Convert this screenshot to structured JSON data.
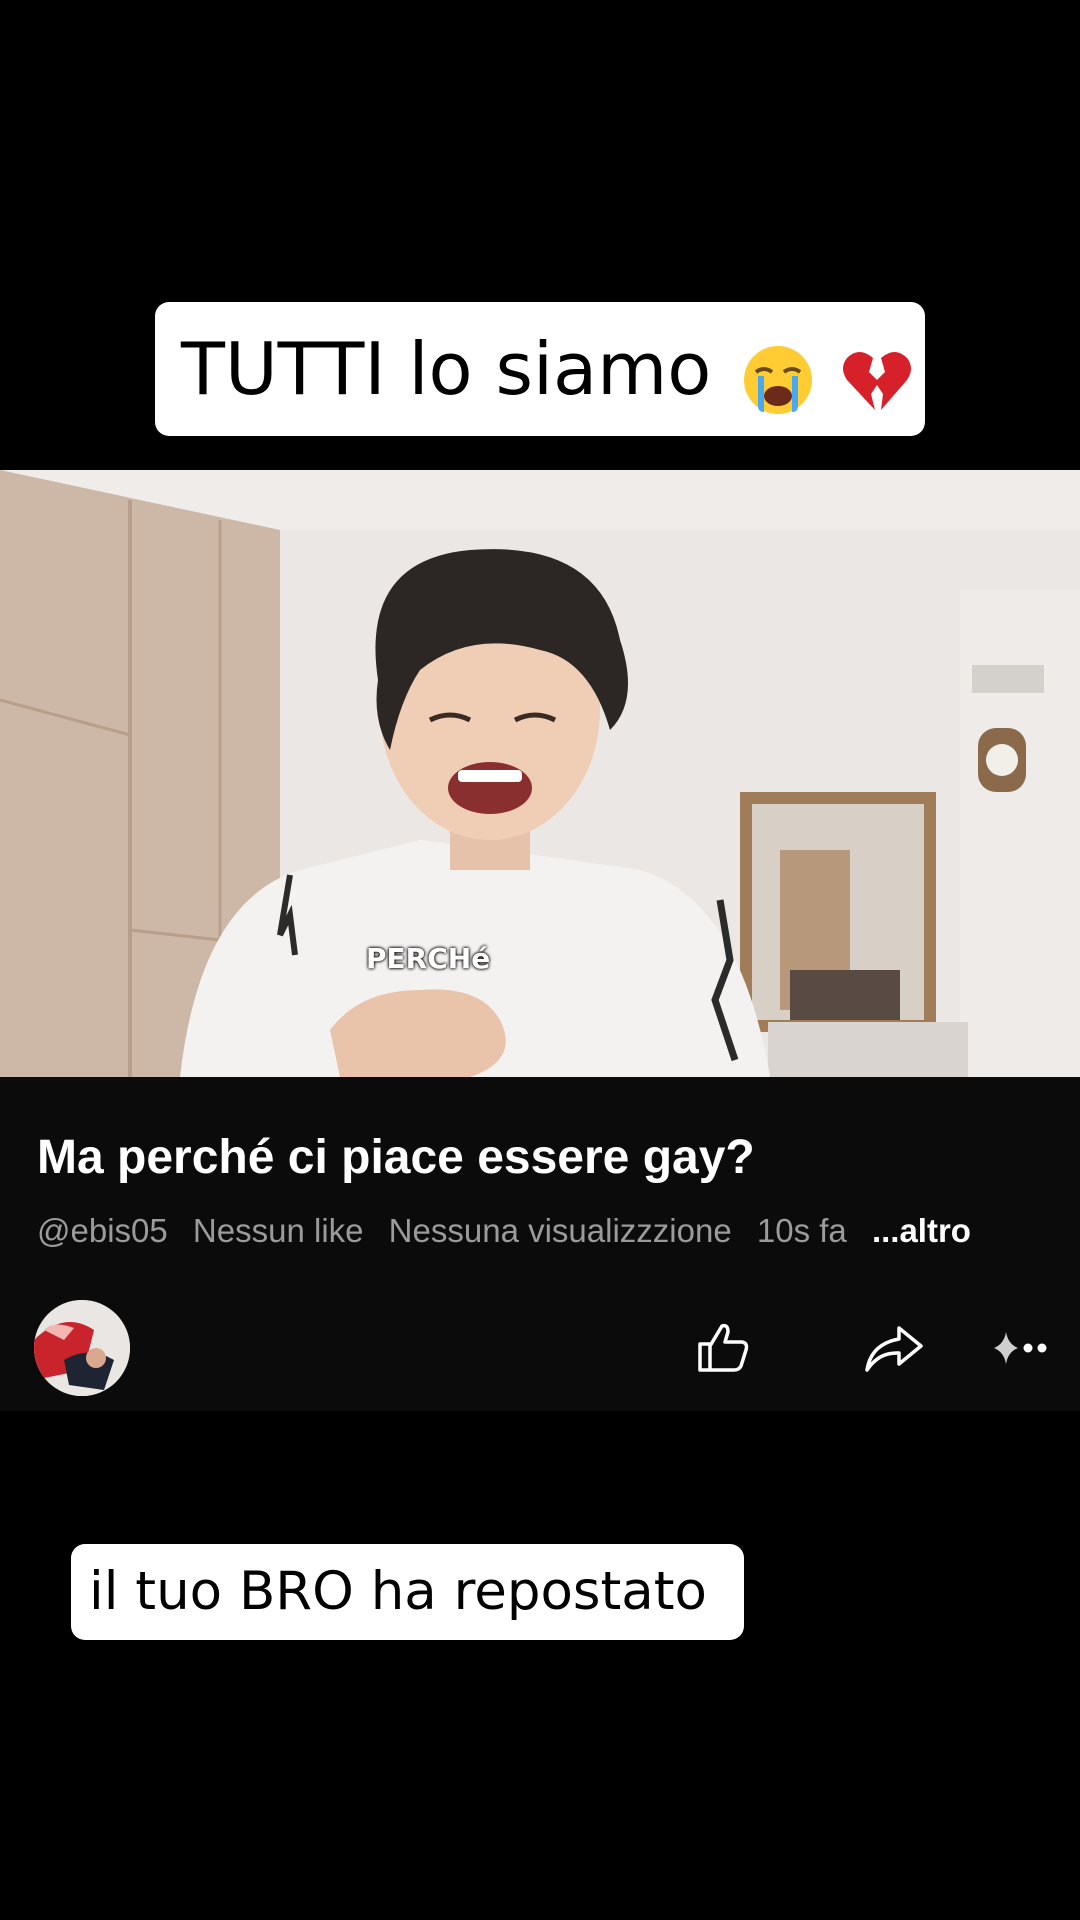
{
  "captions": {
    "top": "TUTTI lo siamo",
    "top_emoji": "😭💔",
    "bottom": "il tuo BRO ha repostato"
  },
  "video": {
    "overlay_text": "PERCHé"
  },
  "post": {
    "title": "Ma perché ci piace essere gay?",
    "handle": "@ebis05",
    "likes": "Nessun like",
    "views": "Nessuna visualizzzione",
    "time": "10s fa",
    "more_label": "...altro"
  },
  "icons": {
    "like": "thumbs-up-icon",
    "share": "share-arrow-icon",
    "more": "sparkle-more-icon"
  }
}
